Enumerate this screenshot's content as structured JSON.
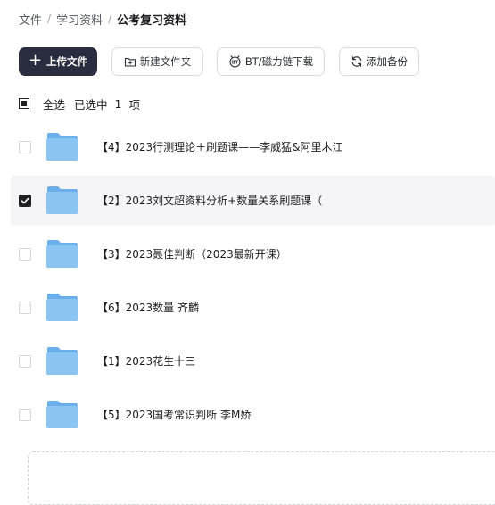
{
  "breadcrumb": {
    "items": [
      "文件",
      "学习资料",
      "公考复习资料"
    ],
    "separator": "/"
  },
  "toolbar": {
    "upload_label": "上传文件",
    "new_folder_label": "新建文件夹",
    "bt_label": "BT/磁力链下载",
    "backup_label": "添加备份"
  },
  "selection": {
    "select_all_label": "全选",
    "selected_prefix": "已选中",
    "selected_count": "1",
    "selected_suffix": "项"
  },
  "files": [
    {
      "name": "【4】2023行测理论＋刷题课——李威猛&阿里木江",
      "selected": false
    },
    {
      "name": "【2】2023刘文超资料分析+数量关系刷题课（",
      "selected": true
    },
    {
      "name": "【3】2023聂佳判断（2023最新开课）",
      "selected": false
    },
    {
      "name": "【6】2023数量 齐麟",
      "selected": false
    },
    {
      "name": "【1】2023花生十三",
      "selected": false
    },
    {
      "name": "【5】2023国考常识判断 李M娇",
      "selected": false
    }
  ],
  "colors": {
    "primary_button": "#2a2d3f",
    "folder_blue": "#8cc4f2",
    "selected_row": "#f5f5f7"
  }
}
